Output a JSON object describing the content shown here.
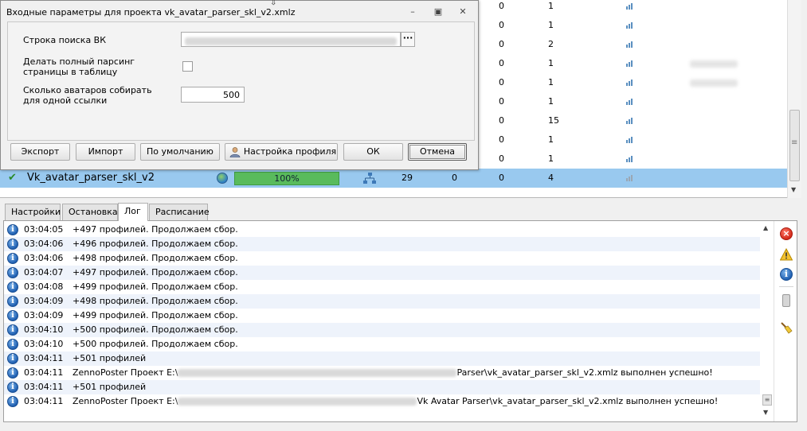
{
  "dialog": {
    "title": "Входные параметры для проекта vk_avatar_parser_skl_v2.xmlz",
    "fields": {
      "search_label": "Строка поиска ВК",
      "full_parse_label": "Делать полный парсинг страницы в таблицу",
      "full_parse_checked": false,
      "count_label": "Сколько аватаров собирать для одной ссылки",
      "count_value": "500"
    },
    "buttons": {
      "export": "Экспорт",
      "import": "Импорт",
      "default": "По умолчанию",
      "profile": "Настройка профиля",
      "ok": "ОК",
      "cancel": "Отмена"
    }
  },
  "grid": {
    "rows": [
      {
        "a": "0",
        "b": "1"
      },
      {
        "a": "0",
        "b": "1"
      },
      {
        "a": "0",
        "b": "2"
      },
      {
        "a": "0",
        "b": "1"
      },
      {
        "a": "0",
        "b": "1"
      },
      {
        "a": "0",
        "b": "1"
      },
      {
        "a": "0",
        "b": "15"
      },
      {
        "a": "0",
        "b": "1"
      },
      {
        "a": "0",
        "b": "1"
      }
    ],
    "selected": {
      "name": "Vk_avatar_parser_skl_v2",
      "progress": "100%",
      "progress_value": 100,
      "v1": "29",
      "v2": "0",
      "v3": "0",
      "v4": "4"
    }
  },
  "tabs": [
    "Настройки",
    "Остановка",
    "Лог",
    "Расписание"
  ],
  "active_tab": "Лог",
  "log": [
    {
      "time": "03:04:05",
      "msg": "+497 профилей. Продолжаем сбор."
    },
    {
      "time": "03:04:06",
      "msg": "+496 профилей. Продолжаем сбор."
    },
    {
      "time": "03:04:06",
      "msg": "+498 профилей. Продолжаем сбор."
    },
    {
      "time": "03:04:07",
      "msg": "+497 профилей. Продолжаем сбор."
    },
    {
      "time": "03:04:08",
      "msg": "+499 профилей. Продолжаем сбор."
    },
    {
      "time": "03:04:09",
      "msg": "+498 профилей. Продолжаем сбор."
    },
    {
      "time": "03:04:09",
      "msg": "+499 профилей. Продолжаем сбор."
    },
    {
      "time": "03:04:10",
      "msg": "+500 профилей. Продолжаем сбор."
    },
    {
      "time": "03:04:10",
      "msg": "+500 профилей. Продолжаем сбор."
    },
    {
      "time": "03:04:11",
      "msg": "+501 профилей"
    },
    {
      "time": "03:04:11",
      "msg_prefix": "ZennoPoster Проект E:\\",
      "msg_suffix": "Parser\\vk_avatar_parser_skl_v2.xmlz выполнен успешно!"
    },
    {
      "time": "03:04:11",
      "msg": "+501 профилей"
    },
    {
      "time": "03:04:11",
      "msg_prefix": "ZennoPoster Проект E:\\",
      "msg_suffix": "Vk Avatar Parser\\vk_avatar_parser_skl_v2.xmlz выполнен успешно!"
    }
  ],
  "icons": {
    "info": "info-icon",
    "error_filter": "error-icon",
    "warning_filter": "warning-icon",
    "info_filter": "info-icon",
    "clear": "broom-icon"
  },
  "colors": {
    "selection": "#99c9ef",
    "progress": "#59bb5c",
    "alt_row": "#eef3fb"
  }
}
